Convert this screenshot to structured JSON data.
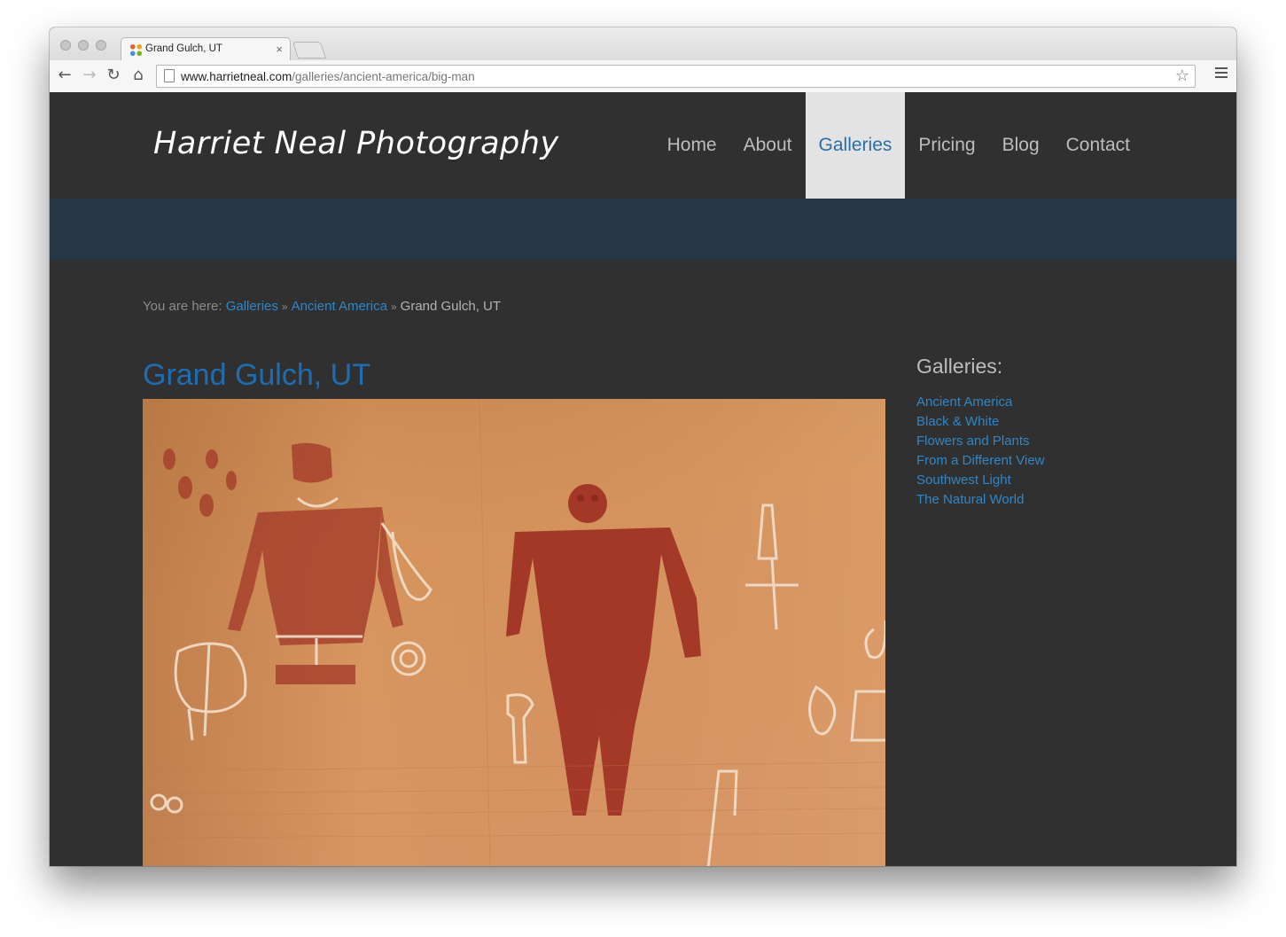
{
  "browser": {
    "tab_title": "Grand Gulch, UT",
    "tab_close": "×",
    "url_host": "www.harrietneal.com",
    "url_path": "/galleries/ancient-america/big-man",
    "back_glyph": "←",
    "forward_glyph": "→",
    "reload_glyph": "↻",
    "home_glyph": "⌂",
    "star_glyph": "☆"
  },
  "site": {
    "title": "Harriet Neal Photography",
    "nav": [
      {
        "label": "Home",
        "active": false
      },
      {
        "label": "About",
        "active": false
      },
      {
        "label": "Galleries",
        "active": true
      },
      {
        "label": "Pricing",
        "active": false
      },
      {
        "label": "Blog",
        "active": false
      },
      {
        "label": "Contact",
        "active": false
      }
    ],
    "colors": {
      "background": "#303030",
      "banner": "#273644",
      "link": "#2f86c7",
      "heading": "#1f6db0",
      "active_nav_bg": "#e3e3e3"
    }
  },
  "breadcrumb": {
    "prefix": "You are here:",
    "links": [
      "Galleries",
      "Ancient America"
    ],
    "separator": "»",
    "current": "Grand Gulch, UT"
  },
  "main": {
    "heading": "Grand Gulch, UT",
    "image_subject": "rock-art petroglyph photo"
  },
  "sidebar": {
    "title": "Galleries:",
    "items": [
      "Ancient America",
      "Black & White",
      "Flowers and Plants",
      "From a Different View",
      "Southwest Light",
      "The Natural World"
    ]
  }
}
